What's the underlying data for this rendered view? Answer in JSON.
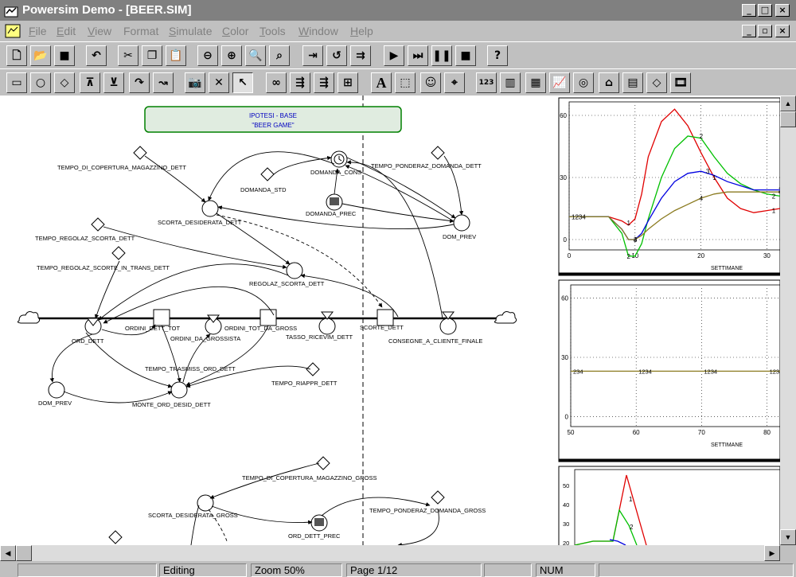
{
  "window": {
    "title": "Powersim Demo - [BEER.SIM]"
  },
  "menu": [
    "File",
    "Edit",
    "View",
    "Format",
    "Simulate",
    "Color",
    "Tools",
    "Window",
    "Help"
  ],
  "model": {
    "header_line1": "IPOTESI - BASE",
    "header_line2": "\"BEER GAME\"",
    "labels": {
      "tempo_copertura_dett": "TEMPO_DI_COPERTURA_MAGAZZINO_DETT",
      "domanda_cons": "DOMANDA_CONS",
      "tempo_ponderaz_dett": "TEMPO_PONDERAZ_DOMANDA_DETT",
      "domanda_std": "DOMANDA_STD",
      "domanda_prec": "DOMANDA_PREC",
      "scorta_desiderata_dett": "SCORTA_DESIDERATA_DETT",
      "dom_prev": "DOM_PREV",
      "tempo_regolaz_scorta_dett": "TEMPO_REGOLAZ_SCORTA_DETT",
      "tempo_regolaz_scorte_trans": "TEMPO_REGOLAZ_SCORTE_IN_TRANS_DETT",
      "regolaz_scorta_dett": "REGOLAZ_SCORTA_DETT",
      "ordini_dett_tot": "ORDINI_DETT_TOT",
      "ordini_tot_da_gross": "ORDINI_TOT_DA_GROSS",
      "ordini_da_grossista": "ORDINI_DA_GROSSISTA",
      "scorte_dett": "SCORTE_DETT",
      "ord_dett": "ORD_DETT",
      "tasso_ricevim_dett": "TASSO_RICEVIM_DETT",
      "consegne_cliente_finale": "CONSEGNE_A_CLIENTE_FINALE",
      "tempo_trasmiss_ord_dett": "TEMPO_TRASMISS_ORD_DETT",
      "tempo_riappr_dett": "TEMPO_RIAPPR_DETT",
      "dom_prev_2": "DOM_PREV",
      "monte_ord_desid_dett": "MONTE_ORD_DESID_DETT",
      "tempo_copertura_gross": "TEMPO_DI_COPERTURA_MAGAZZINO_GROSS",
      "tempo_ponderaz_gross": "TEMPO_PONDERAZ_DOMANDA_GROSS",
      "scorta_desiderata_gross": "SCORTA_DESIDERATA_GROSS",
      "ord_dett_prec": "ORD_DETT_PREC"
    }
  },
  "chart_data": [
    {
      "type": "line",
      "xlabel": "SETTIMANE",
      "xticks": [
        "0",
        "10",
        "20",
        "30"
      ],
      "yticks": [
        "60",
        "30",
        "0"
      ],
      "xlim": [
        0,
        32
      ],
      "ylim": [
        -5,
        65
      ],
      "start_label": "1234",
      "series": [
        {
          "name": "1",
          "color": "#e00000",
          "x": [
            0,
            4,
            6,
            8,
            9,
            10,
            11,
            12,
            14,
            16,
            18,
            20,
            22,
            24,
            26,
            28,
            30,
            32
          ],
          "y": [
            11,
            11,
            11,
            9,
            7,
            10,
            22,
            40,
            57,
            63,
            55,
            42,
            30,
            20,
            15,
            13,
            14,
            15
          ]
        },
        {
          "name": "2",
          "color": "#00c000",
          "x": [
            0,
            4,
            6,
            8,
            9,
            10,
            11,
            12,
            14,
            16,
            18,
            20,
            22,
            24,
            26,
            28,
            30,
            32
          ],
          "y": [
            11,
            11,
            11,
            3,
            -8,
            -8,
            -2,
            10,
            30,
            44,
            50,
            49,
            40,
            32,
            27,
            24,
            22,
            21
          ]
        },
        {
          "name": "3",
          "color": "#0000e0",
          "x": [
            0,
            4,
            6,
            8,
            9,
            10,
            11,
            12,
            14,
            16,
            18,
            20,
            22,
            24,
            26,
            28,
            30,
            32
          ],
          "y": [
            11,
            11,
            11,
            5,
            0,
            0,
            3,
            9,
            20,
            28,
            32,
            33,
            31,
            28,
            26,
            24,
            24,
            24
          ]
        },
        {
          "name": "4",
          "color": "#8b7b20",
          "x": [
            0,
            4,
            6,
            8,
            9,
            10,
            11,
            12,
            14,
            16,
            18,
            20,
            22,
            24,
            26,
            28,
            30,
            32
          ],
          "y": [
            11,
            11,
            11,
            5,
            0,
            0,
            2,
            5,
            10,
            14,
            17,
            20,
            22,
            23,
            23,
            23,
            23,
            23
          ]
        }
      ]
    },
    {
      "type": "line",
      "xlabel": "SETTIMANE",
      "xticks": [
        "50",
        "60",
        "70",
        "80"
      ],
      "yticks": [
        "60",
        "30",
        "0"
      ],
      "xlim": [
        50,
        82
      ],
      "ylim": [
        -5,
        65
      ],
      "point_labels": [
        "234",
        "1234",
        "1234",
        "1234"
      ],
      "series": [
        {
          "name": "1234",
          "color": "#8b7b20",
          "x": [
            50,
            82
          ],
          "y": [
            23,
            23
          ]
        }
      ]
    },
    {
      "type": "line",
      "xlabel": "",
      "yticks": [
        "50",
        "40",
        "30",
        "20"
      ],
      "series": [
        {
          "name": "1",
          "color": "#e00000"
        },
        {
          "name": "2",
          "color": "#00c000"
        }
      ]
    }
  ],
  "status": {
    "mode": "Editing",
    "zoom": "Zoom 50%",
    "page": "Page  1/12",
    "num": "NUM"
  }
}
